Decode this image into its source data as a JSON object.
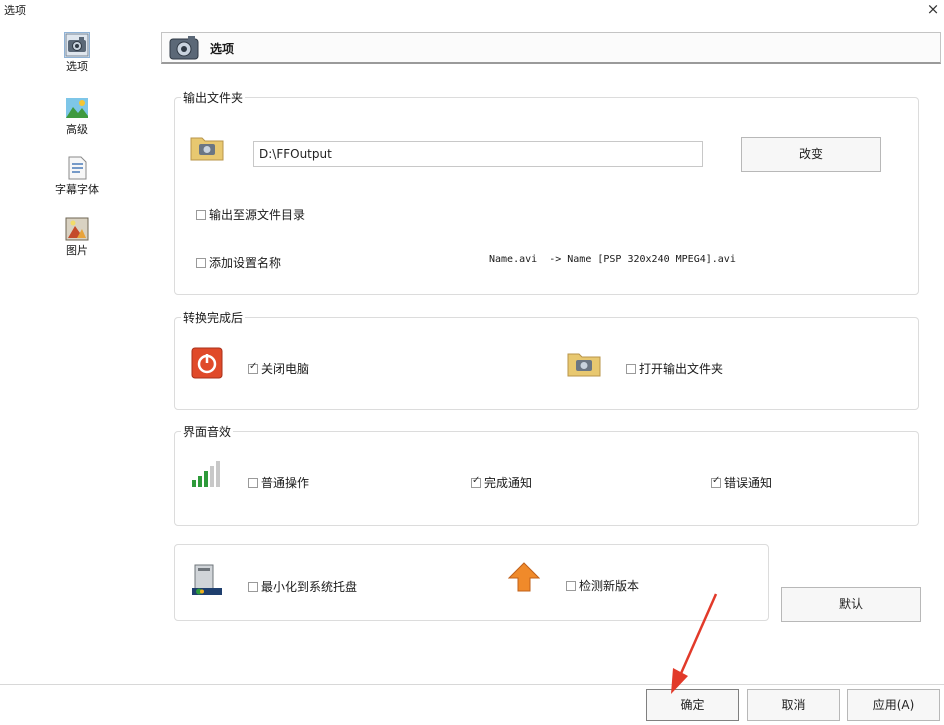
{
  "window": {
    "title": "选项",
    "close_glyph": "×"
  },
  "sidebar": {
    "items": [
      {
        "label": "选项",
        "icon": "camera-icon",
        "selected": true
      },
      {
        "label": "高级",
        "icon": "landscape-icon",
        "selected": false
      },
      {
        "label": "字幕字体",
        "icon": "document-icon",
        "selected": false
      },
      {
        "label": "图片",
        "icon": "picture-icon",
        "selected": false
      }
    ]
  },
  "header": {
    "title": "选项",
    "icon": "camera-icon"
  },
  "output": {
    "group_title": "输出文件夹",
    "path": "D:\\FFOutput",
    "change_label": "改变",
    "output_to_source": {
      "label": "输出至源文件目录",
      "checked": false
    },
    "add_setting_name": {
      "label": "添加设置名称",
      "checked": false
    },
    "example": "Name.avi  -> Name [PSP 320x240 MPEG4].avi"
  },
  "after": {
    "group_title": "转换完成后",
    "shutdown": {
      "label": "关闭电脑",
      "checked": true
    },
    "open_folder": {
      "label": "打开输出文件夹",
      "checked": false
    }
  },
  "sound": {
    "group_title": "界面音效",
    "normal": {
      "label": "普通操作",
      "checked": false
    },
    "done": {
      "label": "完成通知",
      "checked": true
    },
    "error": {
      "label": "错误通知",
      "checked": true
    }
  },
  "misc": {
    "minimize_tray": {
      "label": "最小化到系统托盘",
      "checked": false
    },
    "check_update": {
      "label": "检测新版本",
      "checked": false
    }
  },
  "buttons": {
    "default": "默认",
    "ok": "确定",
    "cancel": "取消",
    "apply": "应用(A)"
  },
  "colors": {
    "accent_red": "#e04a2a",
    "folder": "#e8c870",
    "arrow": "#e23a2a"
  }
}
